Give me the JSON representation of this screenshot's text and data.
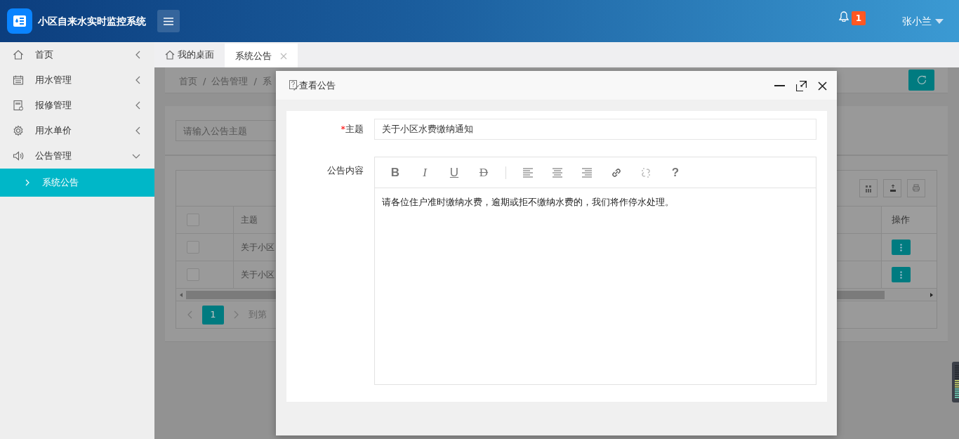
{
  "header": {
    "title": "小区自来水实时监控系统",
    "notification_count": "1",
    "user": "张小兰"
  },
  "sidebar": {
    "items": [
      {
        "label": "首页",
        "selected": false,
        "expanded": false
      },
      {
        "label": "用水管理",
        "selected": false,
        "expanded": false
      },
      {
        "label": "报修管理",
        "selected": false,
        "expanded": false
      },
      {
        "label": "用水单价",
        "selected": false,
        "expanded": false
      },
      {
        "label": "公告管理",
        "selected": false,
        "expanded": true,
        "children": [
          {
            "label": "系统公告",
            "selected": true
          }
        ]
      }
    ]
  },
  "tabs": [
    {
      "label": "我的桌面",
      "selected": false,
      "closable": false
    },
    {
      "label": "系统公告",
      "selected": true,
      "closable": true
    }
  ],
  "breadcrumb": [
    {
      "kind": "item",
      "label": "首页"
    },
    {
      "kind": "separator",
      "label": "/"
    },
    {
      "kind": "item",
      "label": "公告管理"
    },
    {
      "kind": "separator",
      "label": "/"
    },
    {
      "kind": "item",
      "label": "系"
    }
  ],
  "search": {
    "placeholder": "请输入公告主题"
  },
  "table": {
    "all_checked": false,
    "columns": [
      "主题",
      "操作"
    ],
    "rows": [
      {
        "column_1": "关于小区",
        "checked": false
      },
      {
        "column_1": "关于小区",
        "checked": false
      }
    ]
  },
  "pagination": {
    "pages": [
      {
        "label": "1",
        "selected": true
      }
    ],
    "goto_label": "到第"
  },
  "modal": {
    "title": "查看公告",
    "subject": {
      "required_mark": "*",
      "label": "主题",
      "value": "关于小区水费缴纳通知"
    },
    "content": {
      "label": "公告内容",
      "toolbar_groups": [
        [
          {
            "kind": "bold",
            "label": "B",
            "disabled": false
          },
          {
            "kind": "italic",
            "label": "I",
            "disabled": false
          },
          {
            "kind": "underline",
            "label": "U",
            "disabled": false
          },
          {
            "kind": "strike",
            "label": "D",
            "disabled": false
          }
        ],
        [
          {
            "kind": "align-left",
            "disabled": false
          },
          {
            "kind": "align-center",
            "disabled": false
          },
          {
            "kind": "align-right",
            "disabled": false
          },
          {
            "kind": "link",
            "disabled": false
          },
          {
            "kind": "unlink",
            "disabled": true
          },
          {
            "kind": "help",
            "label": "?",
            "disabled": false
          }
        ]
      ],
      "text": "请各位住户准时缴纳水费，逾期或拒不缴纳水费的，我们将作停水处理。"
    }
  }
}
